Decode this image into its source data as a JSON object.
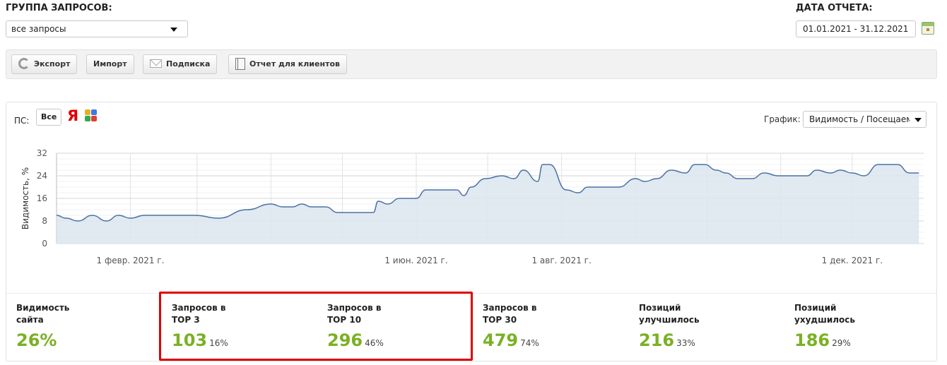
{
  "filters": {
    "group_label": "ГРУППА ЗАПРОСОВ:",
    "group_value": "все запросы",
    "date_label": "ДАТА ОТЧЕТА:",
    "date_value": "01.01.2021 - 31.12.2021"
  },
  "toolbar": {
    "export_label": "Экспорт",
    "import_label": "Импорт",
    "subscribe_label": "Подписка",
    "client_report_label": "Отчет для клиентов"
  },
  "chart_controls": {
    "ps_label": "ПС:",
    "ps_all_label": "Все",
    "yandex_glyph": "Я",
    "graph_label": "График:",
    "graph_value": "Видимость / Посещаемость"
  },
  "chart_data": {
    "type": "area",
    "ylabel": "Видимость, %",
    "xlabel": "",
    "ylim": [
      0,
      32
    ],
    "yticks": [
      0,
      8,
      16,
      24,
      32
    ],
    "xlim": [
      "2021-01-01",
      "2021-12-31"
    ],
    "xticks": [
      {
        "date": "2021-02-01",
        "label": "1 февр. 2021 г."
      },
      {
        "date": "2021-06-01",
        "label": "1 июн. 2021 г."
      },
      {
        "date": "2021-08-01",
        "label": "1 авг. 2021 г."
      },
      {
        "date": "2021-12-01",
        "label": "1 дек. 2021 г."
      }
    ],
    "vgrid_dates": [
      "2021-02-01",
      "2021-03-01",
      "2021-04-01",
      "2021-05-01",
      "2021-06-01",
      "2021-07-01",
      "2021-08-01",
      "2021-09-01",
      "2021-10-01",
      "2021-11-01",
      "2021-12-01"
    ],
    "color": "#4a72a3",
    "fill": "#dce5ef",
    "series": [
      {
        "x": [
          "2021-01-01",
          "2021-01-05",
          "2021-01-10",
          "2021-01-16",
          "2021-01-22",
          "2021-01-27",
          "2021-02-01",
          "2021-02-07",
          "2021-02-14",
          "2021-02-28",
          "2021-03-10",
          "2021-03-22",
          "2021-04-01",
          "2021-04-06",
          "2021-04-10",
          "2021-04-14",
          "2021-04-18",
          "2021-04-24",
          "2021-04-29",
          "2021-05-07",
          "2021-05-14",
          "2021-05-16",
          "2021-05-20",
          "2021-05-25",
          "2021-05-30",
          "2021-06-01",
          "2021-06-05",
          "2021-06-10",
          "2021-06-14",
          "2021-06-18",
          "2021-06-21",
          "2021-06-24",
          "2021-06-30",
          "2021-07-07",
          "2021-07-12",
          "2021-07-16",
          "2021-07-22",
          "2021-07-24",
          "2021-07-27",
          "2021-08-03",
          "2021-08-08",
          "2021-08-12",
          "2021-08-18",
          "2021-08-25",
          "2021-09-01",
          "2021-09-05",
          "2021-09-10",
          "2021-09-16",
          "2021-09-22",
          "2021-09-26",
          "2021-09-30",
          "2021-10-05",
          "2021-10-09",
          "2021-10-14",
          "2021-10-20",
          "2021-10-25",
          "2021-10-31",
          "2021-11-05",
          "2021-11-12",
          "2021-11-16",
          "2021-11-22",
          "2021-11-26",
          "2021-12-01",
          "2021-12-06",
          "2021-12-12",
          "2021-12-17",
          "2021-12-20",
          "2021-12-25",
          "2021-12-29"
        ],
        "y": [
          10,
          9,
          8,
          10,
          8,
          10,
          9,
          10,
          10,
          10,
          9,
          12,
          14,
          13,
          13,
          14,
          13,
          13,
          11,
          11,
          11,
          15,
          14,
          16,
          16,
          16,
          19,
          19,
          19,
          19,
          17,
          20,
          23,
          24,
          23,
          26,
          22,
          28,
          28,
          19,
          18,
          20,
          20,
          20,
          23,
          22,
          23,
          26,
          25,
          28,
          28,
          26,
          25,
          23,
          23,
          25,
          24,
          24,
          24,
          26,
          25,
          26,
          25,
          24,
          28,
          28,
          28,
          25,
          25
        ]
      }
    ]
  },
  "stats": [
    {
      "title_line1": "Видимость",
      "title_line2": "сайта",
      "value": "26%",
      "pct": ""
    },
    {
      "title_line1": "Запросов в",
      "title_line2": "ТОР 3",
      "value": "103",
      "pct": "16%"
    },
    {
      "title_line1": "Запросов в",
      "title_line2": "ТОР 10",
      "value": "296",
      "pct": "46%"
    },
    {
      "title_line1": "Запросов в",
      "title_line2": "ТОР 30",
      "value": "479",
      "pct": "74%"
    },
    {
      "title_line1": "Позиций",
      "title_line2": "улучшилось",
      "value": "216",
      "pct": "33%"
    },
    {
      "title_line1": "Позиций",
      "title_line2": "ухудшилось",
      "value": "186",
      "pct": "29%"
    }
  ]
}
